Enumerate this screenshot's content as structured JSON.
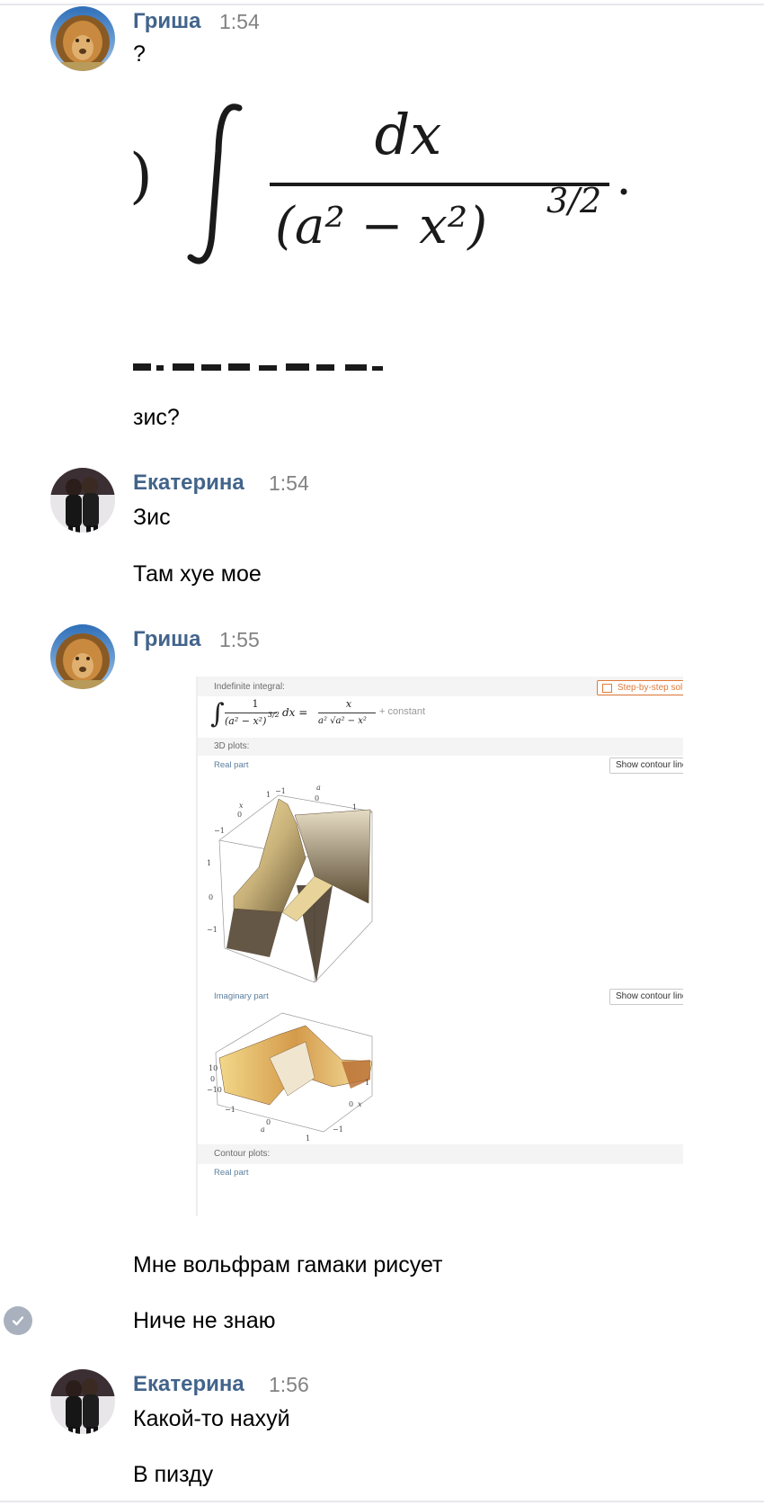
{
  "messages": [
    {
      "author": "Гриша",
      "time": "1:54",
      "lines": [
        "?",
        "зис?"
      ],
      "image_formula": {
        "numerator": "dx",
        "denominator_base": "(a² − x²)",
        "exponent": "3/2",
        "left_paren": ")"
      }
    },
    {
      "author": "Екатерина",
      "time": "1:54",
      "lines": [
        "Зис",
        "Там хуе мое"
      ]
    },
    {
      "author": "Гриша",
      "time": "1:55",
      "wolfram": {
        "indefinite_integral_label": "Indefinite integral:",
        "step_button": "Step-by-step solu",
        "integral_lhs_num": "1",
        "integral_lhs_den": "(a² − x²)",
        "integral_lhs_exp": "3/2",
        "integral_dx": "dx =",
        "integral_rhs_num": "x",
        "integral_rhs_den": "a² √a² − x²",
        "constant": "+ constant",
        "plots_3d_label": "3D plots:",
        "real_part_label": "Real part",
        "show_contour_1": "Show contour line",
        "imag_part_label": "Imaginary part",
        "show_contour_2": "Show contour line",
        "contour_plots_label": "Contour plots:",
        "real_part_label_2": "Real part"
      },
      "lines": [
        "Мне вольфрам гамаки рисует",
        "Ниче не знаю"
      ]
    },
    {
      "author": "Екатерина",
      "time": "1:56",
      "lines": [
        "Какой-то нахуй",
        "В пизду"
      ]
    }
  ],
  "colors": {
    "author": "#42648b",
    "time": "#828282",
    "check": "#a8b1bd"
  },
  "icons": {
    "read_status": "check-icon"
  }
}
